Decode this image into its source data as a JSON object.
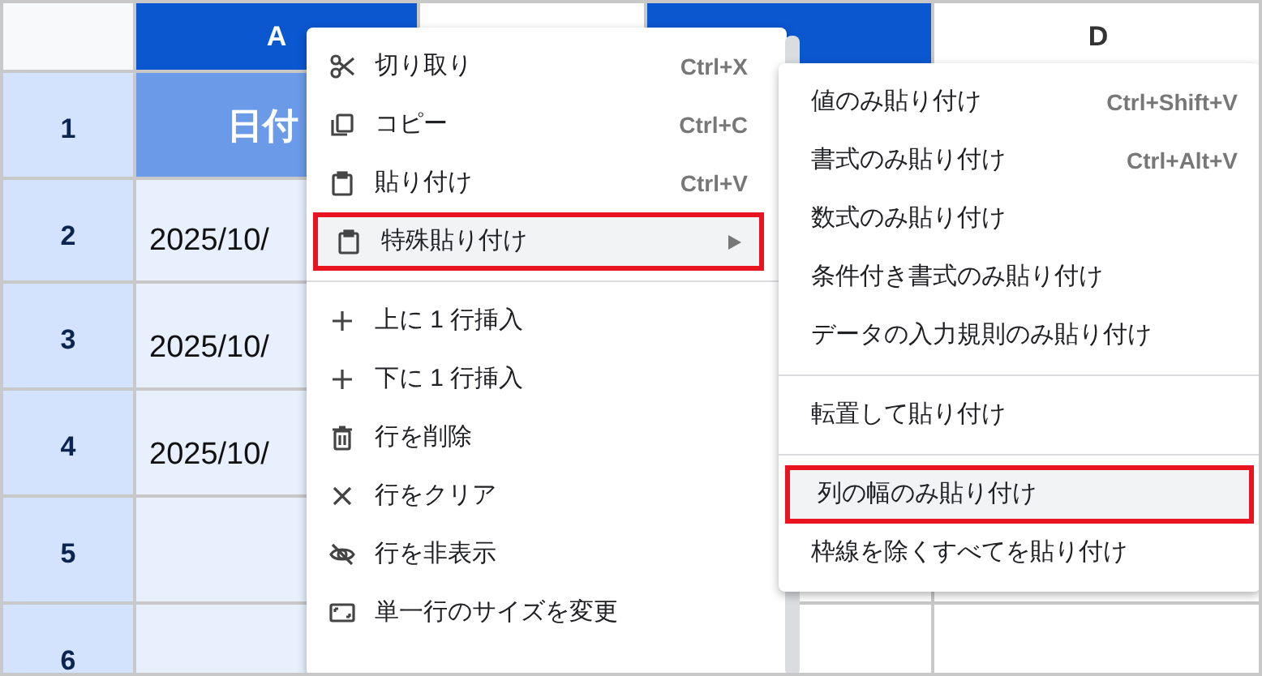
{
  "columns": [
    {
      "label": "A",
      "selected": true
    },
    {
      "selected": false
    },
    {
      "selected": true
    },
    {
      "label": "D",
      "selected": false
    }
  ],
  "rows": [
    {
      "number": "1",
      "cell_a": "日付",
      "kind": "header"
    },
    {
      "number": "2",
      "cell_a": "2025/10/",
      "kind": "data"
    },
    {
      "number": "3",
      "cell_a": "2025/10/",
      "kind": "data"
    },
    {
      "number": "4",
      "cell_a": "2025/10/",
      "kind": "data"
    },
    {
      "number": "5",
      "cell_a": "",
      "kind": "data"
    },
    {
      "number": "6",
      "cell_a": "",
      "kind": "data"
    }
  ],
  "context_menu": [
    {
      "kind": "item",
      "label": "切り取り",
      "shortcut": "Ctrl+X",
      "selected": false
    },
    {
      "kind": "item",
      "label": "コピー",
      "shortcut": "Ctrl+C",
      "selected": false
    },
    {
      "kind": "item",
      "label": "貼り付け",
      "shortcut": "Ctrl+V",
      "selected": false
    },
    {
      "kind": "item",
      "label": "特殊貼り付け",
      "submenu": true,
      "selected": true
    },
    {
      "kind": "divider"
    },
    {
      "kind": "item",
      "label": "上に 1 行挿入",
      "selected": false
    },
    {
      "kind": "item",
      "label": "下に 1 行挿入",
      "selected": false
    },
    {
      "kind": "item",
      "label": "行を削除",
      "selected": false
    },
    {
      "kind": "item",
      "label": "行をクリア",
      "selected": false
    },
    {
      "kind": "item",
      "label": "行を非表示",
      "selected": false
    },
    {
      "kind": "item",
      "label": "単一行のサイズを変更",
      "selected": false
    }
  ],
  "submenu": [
    {
      "kind": "item",
      "label": "値のみ貼り付け",
      "shortcut": "Ctrl+Shift+V",
      "selected": false
    },
    {
      "kind": "item",
      "label": "書式のみ貼り付け",
      "shortcut": "Ctrl+Alt+V",
      "selected": false
    },
    {
      "kind": "item",
      "label": "数式のみ貼り付け",
      "selected": false
    },
    {
      "kind": "item",
      "label": "条件付き書式のみ貼り付け",
      "selected": false
    },
    {
      "kind": "item",
      "label": "データの入力規則のみ貼り付け",
      "selected": false
    },
    {
      "kind": "divider"
    },
    {
      "kind": "item",
      "label": "転置して貼り付け",
      "selected": false
    },
    {
      "kind": "divider"
    },
    {
      "kind": "item",
      "label": "列の幅のみ貼り付け",
      "selected": true
    },
    {
      "kind": "item",
      "label": "枠線を除くすべてを貼り付け",
      "selected": false
    }
  ]
}
